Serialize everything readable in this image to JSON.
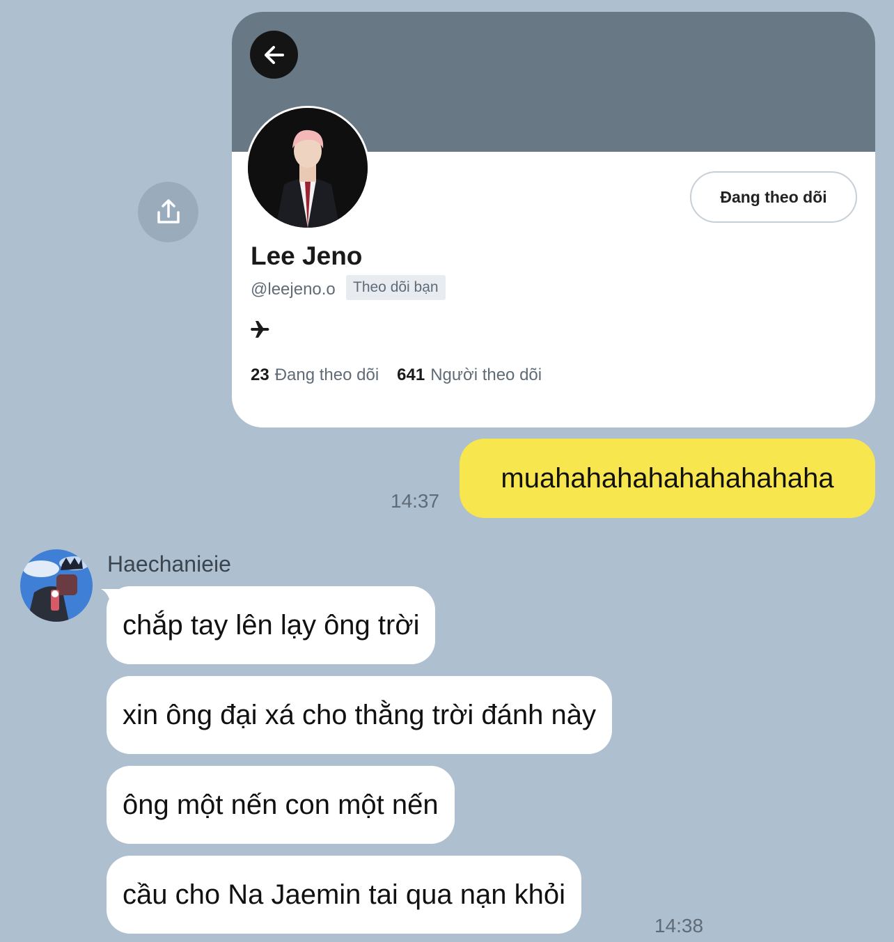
{
  "profile_card": {
    "follow_button_label": "Đang theo dõi",
    "display_name": "Lee Jeno",
    "handle": "@leejeno.o",
    "follows_you_badge": "Theo dõi bạn",
    "bio_icon": "airplane-icon",
    "following_count": "23",
    "following_label": "Đang theo dõi",
    "followers_count": "641",
    "followers_label": "Người theo dõi"
  },
  "messages": {
    "outgoing": {
      "text": "muahahahahahahahahaha",
      "time": "14:37"
    },
    "incoming": {
      "sender": "Haechanieie",
      "lines": [
        "chắp tay lên lạy ông trời",
        "xin ông đại xá cho thằng trời đánh này",
        "ông một nến con một nến",
        "cầu cho Na Jaemin tai qua nạn khỏi"
      ],
      "time": "14:38"
    }
  },
  "colors": {
    "background": "#aebfcf",
    "banner": "#687885",
    "outgoing_bubble": "#f8e64e",
    "incoming_bubble": "#ffffff"
  }
}
